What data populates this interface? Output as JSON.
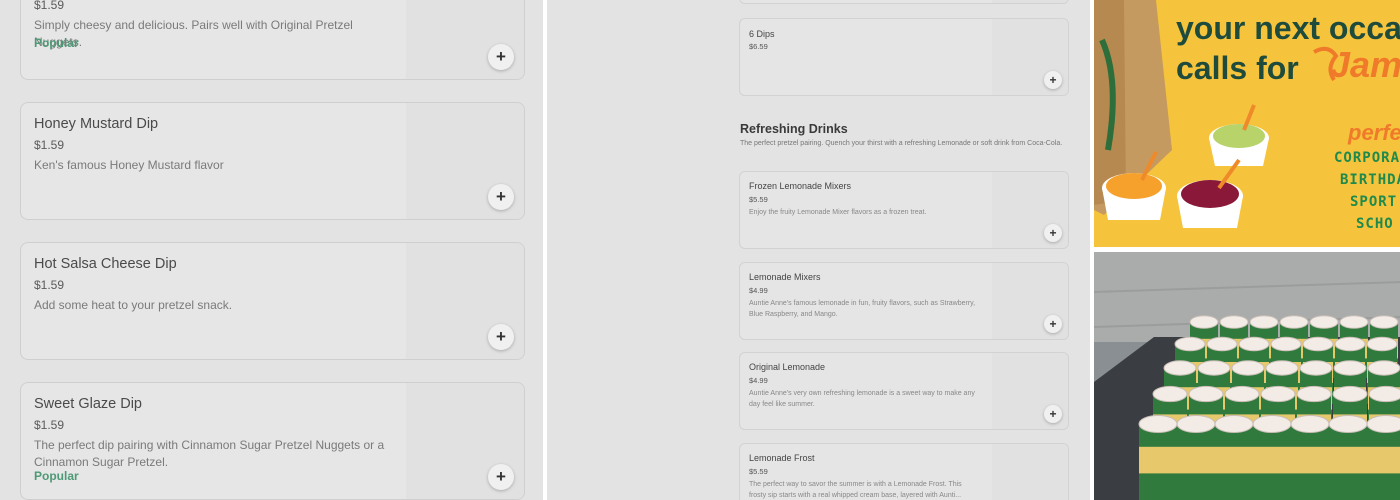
{
  "left_menu": {
    "items": [
      {
        "name": "",
        "price": "$1.59",
        "description": "Simply cheesy and delicious. Pairs well with Original Pretzel Nuggets.",
        "tag": "Popular"
      },
      {
        "name": "Honey Mustard Dip",
        "price": "$1.59",
        "description": "Ken's famous Honey Mustard flavor",
        "tag": ""
      },
      {
        "name": "Hot Salsa Cheese Dip",
        "price": "$1.59",
        "description": "Add some heat to your pretzel snack.",
        "tag": ""
      },
      {
        "name": "Sweet Glaze Dip",
        "price": "$1.59",
        "description": "The perfect dip pairing with Cinnamon Sugar Pretzel Nuggets or a Cinnamon Sugar Pretzel.",
        "tag": "Popular"
      }
    ],
    "add_symbol": "+"
  },
  "middle_menu": {
    "top_item": {
      "name": "6 Dips",
      "price": "$6.59"
    },
    "section": {
      "title": "Refreshing Drinks",
      "description": "The perfect pretzel pairing. Quench your thirst with a refreshing Lemonade or soft drink from Coca-Cola."
    },
    "items": [
      {
        "name": "Frozen Lemonade Mixers",
        "price": "$5.59",
        "description": "Enjoy the fruity Lemonade Mixer flavors as a frozen treat."
      },
      {
        "name": "Lemonade Mixers",
        "price": "$4.99",
        "description": "Auntie Anne's famous lemonade in fun, fruity flavors, such as Strawberry, Blue Raspberry, and Mango."
      },
      {
        "name": "Original Lemonade",
        "price": "$4.99",
        "description": "Auntie Anne's very own refreshing lemonade is a sweet way to make any day feel like summer."
      },
      {
        "name": "Lemonade Frost",
        "price": "$5.59",
        "description": "The perfect way to savor the summer is with a Lemonade Frost. This frosty sip starts with a real whipped cream base, layered with Aunti..."
      }
    ],
    "add_symbol": "+"
  },
  "ad": {
    "headline_line1": "your next occa",
    "headline_line2": "calls for",
    "brand": "Jamba",
    "perf": "perfe",
    "list": [
      "CORPORAT",
      "BIRTHDA",
      "SPORT",
      "SCHO"
    ],
    "colors": {
      "background": "#f6c43c",
      "headline": "#1f4b3c",
      "accent": "#ef7a2a",
      "list": "#1f8a4c"
    }
  }
}
